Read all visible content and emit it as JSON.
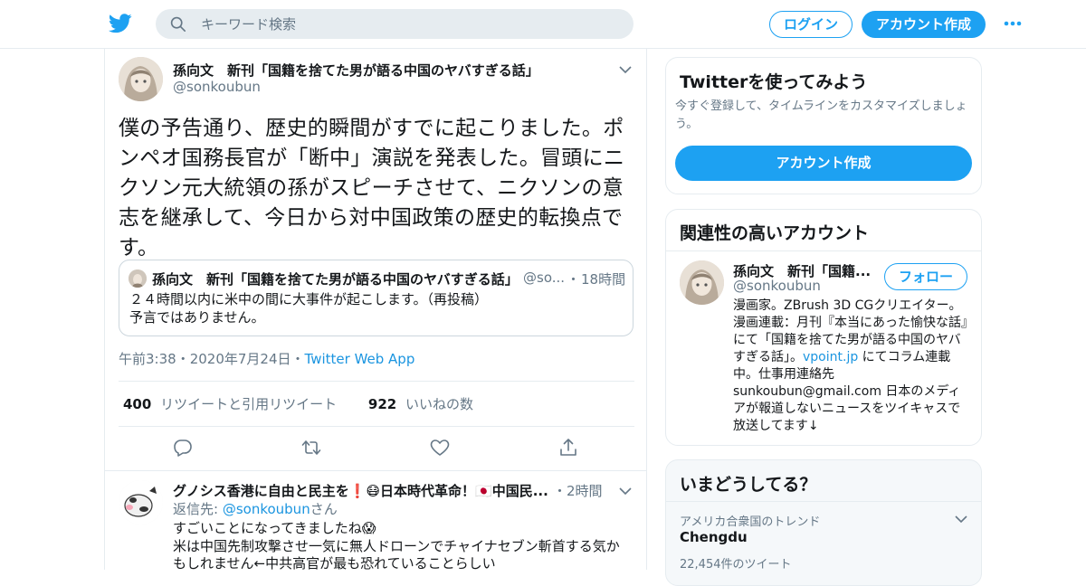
{
  "header": {
    "search_placeholder": "キーワード検索",
    "login_label": "ログイン",
    "signup_label": "アカウント作成",
    "brand_color": "#1da1f2"
  },
  "tweet": {
    "name": "孫向文　新刊「国籍を捨てた男が語る中国のヤバすぎる話」",
    "handle": "@sonkoubun",
    "text": "僕の予告通り、歴史的瞬間がすでに起こりました。ポンペオ国務長官が「断中」演説を発表した。冒頭にニクソン元大統領の孫がスピーチさせて、ニクソンの意志を継承して、今日から対中国政策の歴史的転換点です。",
    "quote": {
      "name": "孫向文　新刊「国籍を捨てた男が語る中国のヤバすぎる話」",
      "handle": "@so...",
      "dot": "・",
      "time": "18時間",
      "text_line1": "２４時間以内に米中の間に大事件が起こします。（再投稿）",
      "text_line2": "予言ではありません。"
    },
    "time": "午前3:38",
    "sep": "・",
    "date": "2020年7月24日",
    "source": "Twitter Web App",
    "retweet_count": "400",
    "retweet_label": "リツイートと引用リツイート",
    "like_count": "922",
    "like_label": "いいねの数"
  },
  "reply": {
    "name": "グノシス香港に自由と民主を❗😷日本時代革命！🇯🇵中国民...",
    "dot": "・",
    "time": "2時間",
    "reply_to_prefix": "返信先: ",
    "reply_to_handle": "@sonkoubun",
    "reply_to_suffix": "さん",
    "line1": "すごいことになってきましたね😱",
    "line2": "米は中国先制攻撃させ一気に無人ドローンでチャイナセブン斬首する気か",
    "line3": "もしれません←中共高官が最も恐れていることらしい"
  },
  "sidebar": {
    "try_title": "Twitterを使ってみよう",
    "try_sub": "今すぐ登録して、タイムラインをカスタマイズしましょう。",
    "try_button": "アカウント作成",
    "related_title": "関連性の高いアカウント",
    "related_name": "孫向文　新刊「国籍...",
    "related_handle": "@sonkoubun",
    "follow_label": "フォロー",
    "bio_part1": "漫画家。ZBrush 3D CGクリエイター。漫画連載：月刊『本当にあった愉快な話』にて「国籍を捨てた男が語る中国のヤバすぎる話」。",
    "bio_link": "vpoint.jp",
    "bio_part2": " にてコラム連載中。仕事用連絡先 sunkoubun@gmail.com 日本のメディアが報道しないニュースをツイキャスで放送してます↓",
    "trend_title": "いまどうしてる？",
    "trend_location": "アメリカ合衆国のトレンド",
    "trend_name": "Chengdu",
    "trend_count": "22,454件のツイート"
  }
}
